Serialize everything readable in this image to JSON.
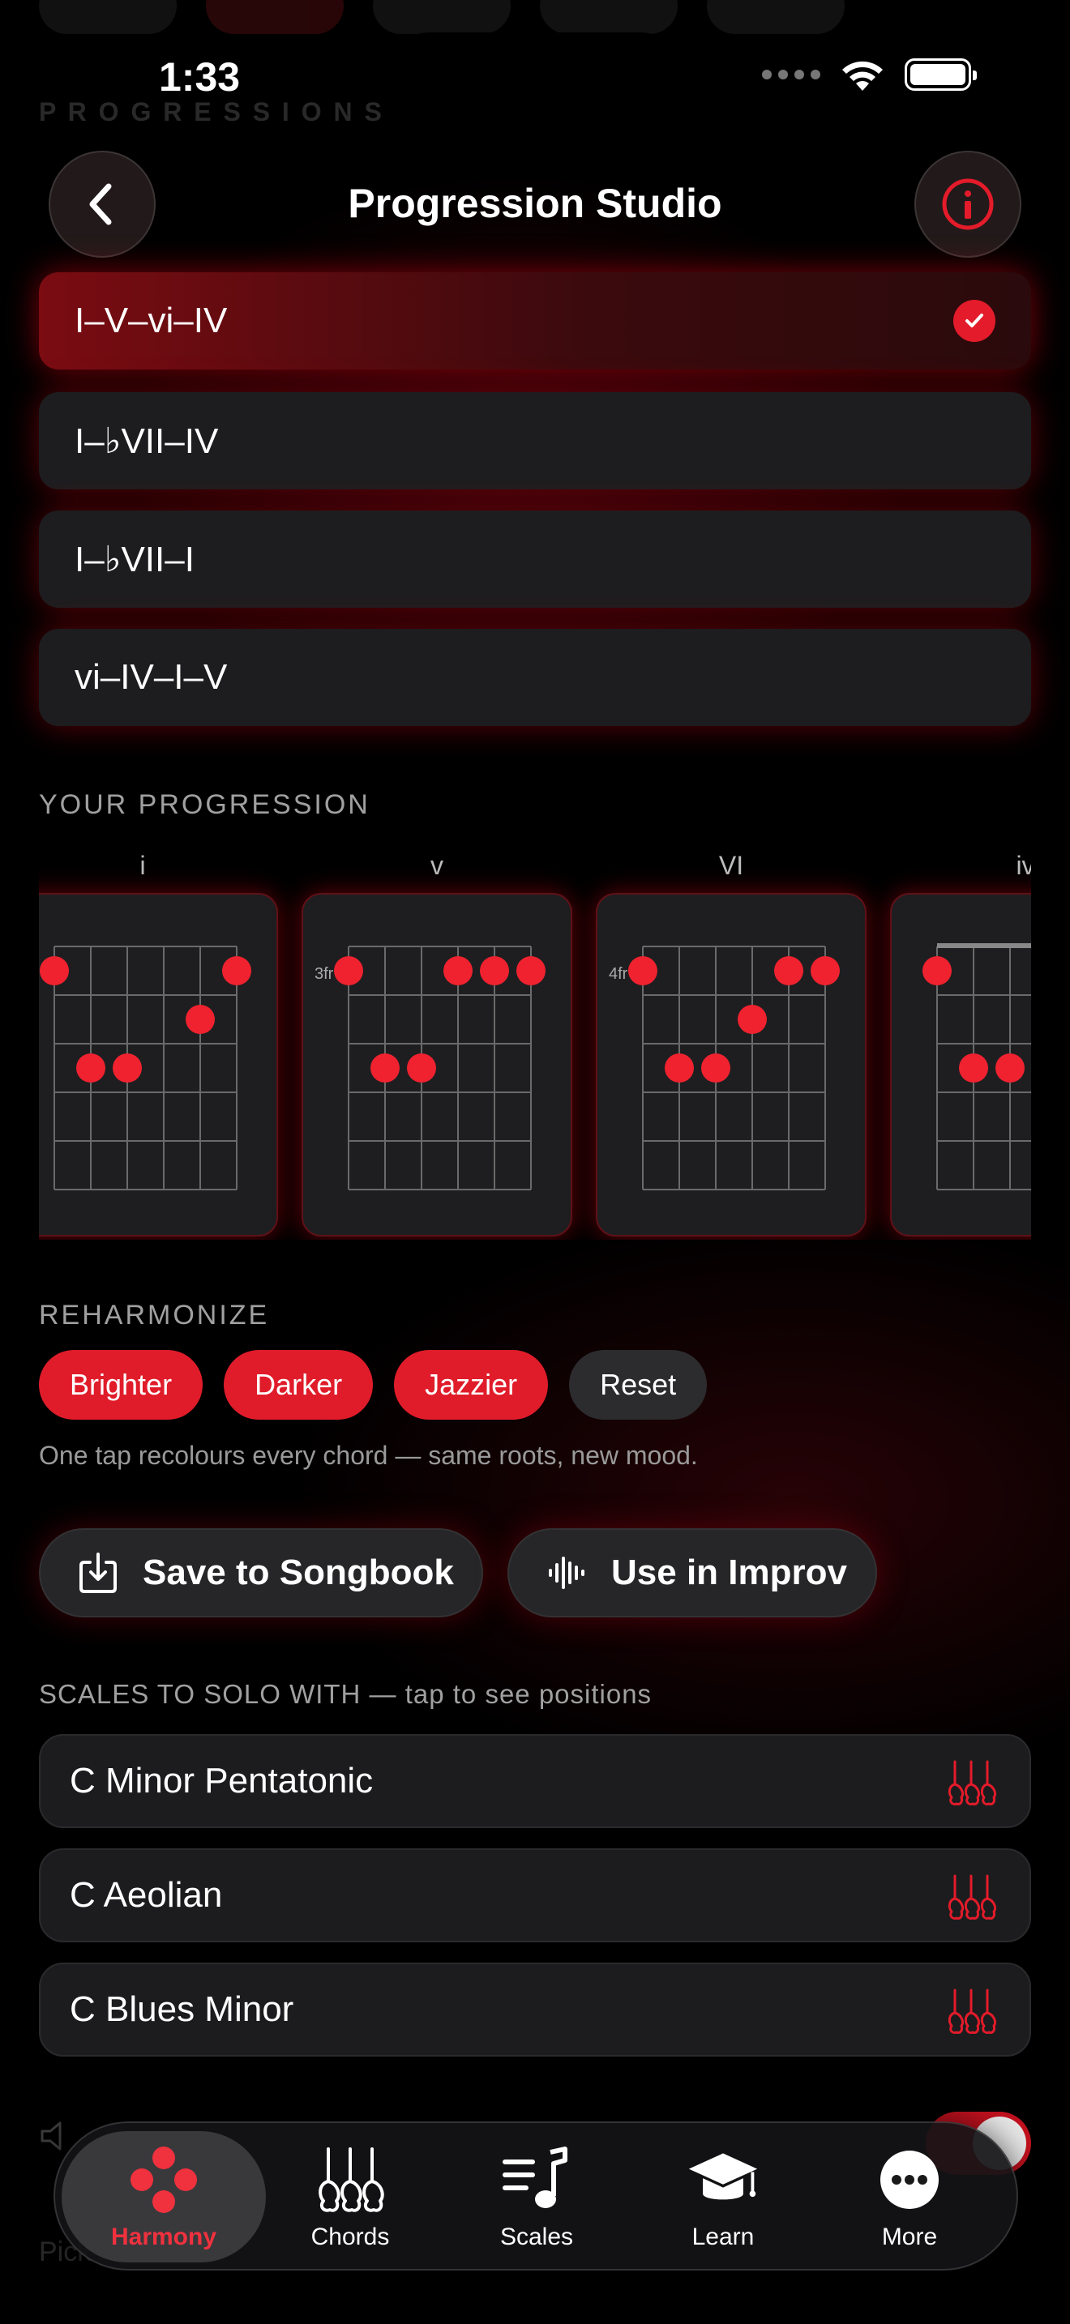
{
  "status": {
    "time": "1:33"
  },
  "header": {
    "title": "Progression Studio",
    "back_icon": "chevron-left-icon",
    "info_icon": "info-icon"
  },
  "progressions": [
    {
      "label": "I–V–vi–IV",
      "selected": true
    },
    {
      "label": "I–♭VII–IV",
      "selected": false
    },
    {
      "label": "I–♭VII–I",
      "selected": false
    },
    {
      "label": "vi–IV–I–V",
      "selected": false
    }
  ],
  "your_progression": {
    "label": "YOUR PROGRESSION",
    "chords": [
      {
        "name": "i",
        "fret": ""
      },
      {
        "name": "v",
        "fret": "3fr"
      },
      {
        "name": "VI",
        "fret": "4fr"
      },
      {
        "name": "iv",
        "fret": ""
      }
    ]
  },
  "reharmonize": {
    "label": "REHARMONIZE",
    "buttons": [
      "Brighter",
      "Darker",
      "Jazzier",
      "Reset"
    ],
    "note": "One tap recolours every chord — same roots, new mood."
  },
  "actions": {
    "save": "Save to Songbook",
    "improv": "Use in Improv"
  },
  "scales": {
    "label": "SCALES TO SOLO WITH — tap to see positions",
    "items": [
      "C Minor Pentatonic",
      "C Aeolian",
      "C Blues Minor"
    ]
  },
  "tabbar": [
    {
      "label": "Harmony",
      "icon": "harmony-icon",
      "active": true
    },
    {
      "label": "Chords",
      "icon": "chords-icon",
      "active": false
    },
    {
      "label": "Scales",
      "icon": "scales-icon",
      "active": false
    },
    {
      "label": "Learn",
      "icon": "learn-icon",
      "active": false
    },
    {
      "label": "More",
      "icon": "more-icon",
      "active": false
    }
  ],
  "colors": {
    "accent": "#e31b2a",
    "background": "#000000",
    "card": "#1d1d1f"
  }
}
